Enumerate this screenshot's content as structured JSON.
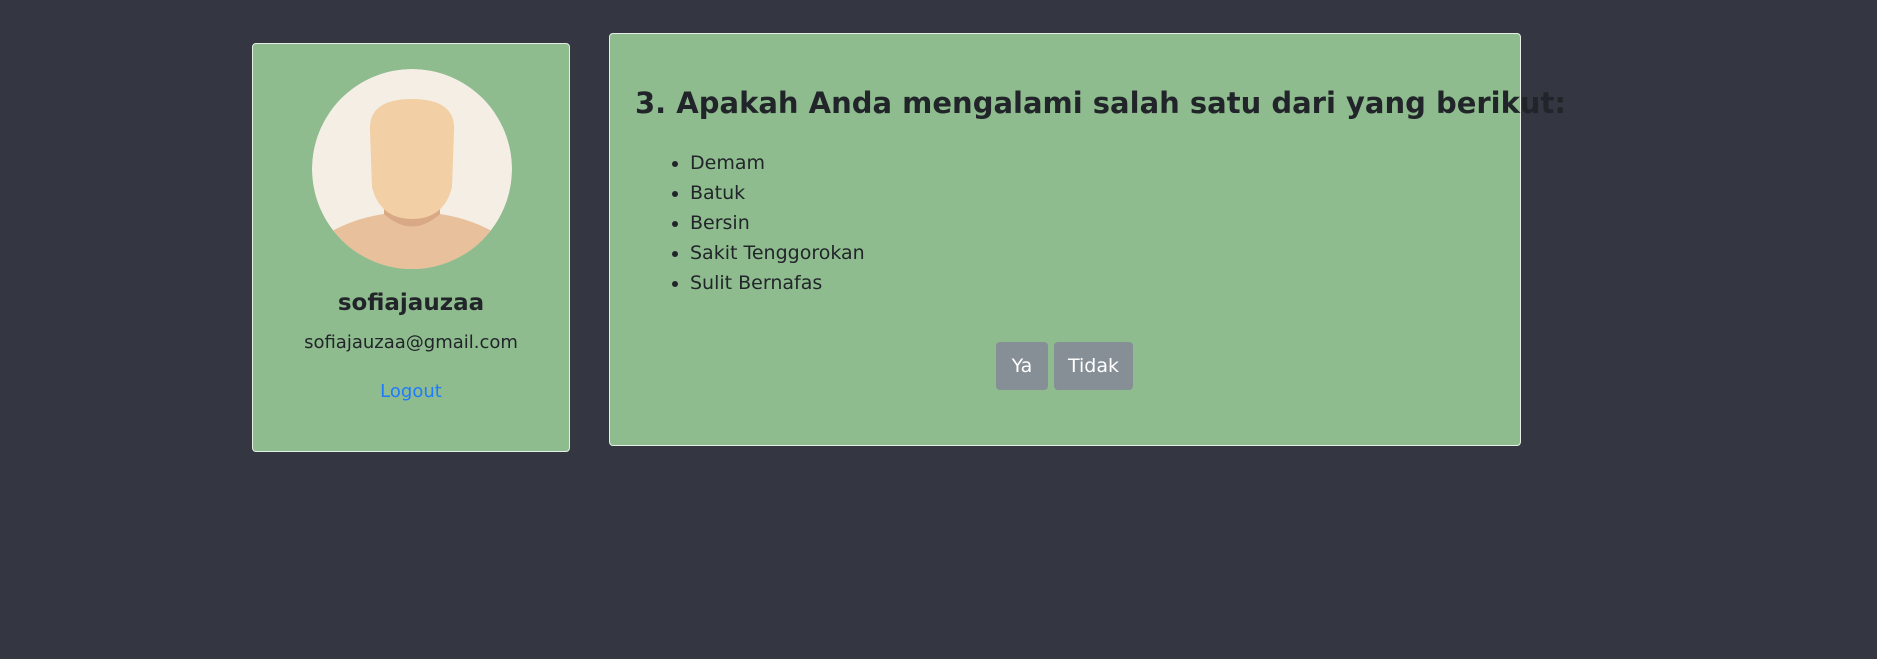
{
  "profile": {
    "username": "sofiajauzaa",
    "email": "sofiajauzaa@gmail.com",
    "logout_label": "Logout",
    "avatar_icon": "user-avatar-icon"
  },
  "question": {
    "title": "3. Apakah Anda mengalami salah satu dari yang berikut:",
    "symptoms": [
      "Demam",
      "Batuk",
      "Bersin",
      "Sakit Tenggorokan",
      "Sulit Bernafas"
    ],
    "yes_label": "Ya",
    "no_label": "Tidak"
  },
  "colors": {
    "background": "#343741",
    "card": "#8fbc8f",
    "link": "#1e7bff",
    "button": "#868e96"
  }
}
